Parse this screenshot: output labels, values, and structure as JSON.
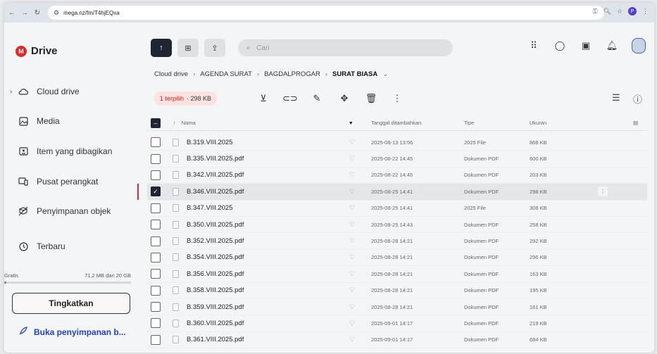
{
  "browser": {
    "url": "mega.nz/fm/T4hjEQxa",
    "profile_initial": "P"
  },
  "brand": {
    "logo_letter": "M",
    "name": "Drive",
    "accent": "#d92b2b"
  },
  "sidebar": {
    "items": [
      {
        "label": "Cloud drive",
        "icon": "cloud-icon"
      },
      {
        "label": "Media",
        "icon": "image-icon"
      },
      {
        "label": "Item yang dibagikan",
        "icon": "shared-folder-icon"
      },
      {
        "label": "Pusat perangkat",
        "icon": "devices-icon"
      },
      {
        "label": "Penyimpanan objek",
        "icon": "object-storage-icon"
      },
      {
        "label": "Terbaru",
        "icon": "clock-icon"
      }
    ],
    "storage_plan": "Gratis",
    "storage_used": "71,2 MB dari 20 GB",
    "storage_fraction": 0.0036,
    "upgrade_label": "Tingkatkan",
    "open_storage_label": "Buka penyimpanan b..."
  },
  "search": {
    "placeholder": "Cari"
  },
  "breadcrumb": [
    "Cloud drive",
    "AGENDA SURAT",
    "BAGDALPROGAR",
    "SURAT BIASA"
  ],
  "selection": {
    "count_label": "1 terpilih",
    "size_label": "· 298 KB"
  },
  "table": {
    "headers": {
      "name": "Nama",
      "date": "Tanggal ditambahkan",
      "type": "Tipe",
      "size": "Ukuran"
    },
    "rows": [
      {
        "name": "B.319.VIII.2025",
        "date": "2025-08-13 13:56",
        "type": "2025 File",
        "size": "868 KB",
        "selected": false
      },
      {
        "name": "B.335.VIII.2025.pdf",
        "date": "2025-08-22 14:45",
        "type": "Dokumen PDF",
        "size": "600 KB",
        "selected": false
      },
      {
        "name": "B.342.VIII.2025.pdf",
        "date": "2025-08-22 14:45",
        "type": "Dokumen PDF",
        "size": "203 KB",
        "selected": false
      },
      {
        "name": "B.346.VIII.2025.pdf",
        "date": "2025-08-25 14:41",
        "type": "Dokumen PDF",
        "size": "298 KB",
        "selected": true
      },
      {
        "name": "B.347.VIII.2025",
        "date": "2025-08-25 14:41",
        "type": "2025 File",
        "size": "308 KB",
        "selected": false
      },
      {
        "name": "B.350.VIII.2025.pdf",
        "date": "2025-08-25 14:43",
        "type": "Dokumen PDF",
        "size": "258 KB",
        "selected": false
      },
      {
        "name": "B.352.VIII.2025.pdf",
        "date": "2025-08-28 14:21",
        "type": "Dokumen PDF",
        "size": "292 KB",
        "selected": false
      },
      {
        "name": "B.354.VIII.2025.pdf",
        "date": "2025-08-28 14:21",
        "type": "Dokumen PDF",
        "size": "296 KB",
        "selected": false
      },
      {
        "name": "B.356.VIII.2025.pdf",
        "date": "2025-08-28 14:21",
        "type": "Dokumen PDF",
        "size": "163 KB",
        "selected": false
      },
      {
        "name": "B.358.VIII.2025.pdf",
        "date": "2025-08-28 14:21",
        "type": "Dokumen PDF",
        "size": "195 KB",
        "selected": false
      },
      {
        "name": "B.359.VIII.2025.pdf",
        "date": "2025-08-28 14:21",
        "type": "Dokumen PDF",
        "size": "161 KB",
        "selected": false
      },
      {
        "name": "B.360.VIII.2025.pdf",
        "date": "2025-09-01 14:17",
        "type": "Dokumen PDF",
        "size": "219 KB",
        "selected": false
      },
      {
        "name": "B.361.VIII.2025.pdf",
        "date": "2025-09-01 14:17",
        "type": "Dokumen PDF",
        "size": "684 KB",
        "selected": false
      }
    ]
  }
}
